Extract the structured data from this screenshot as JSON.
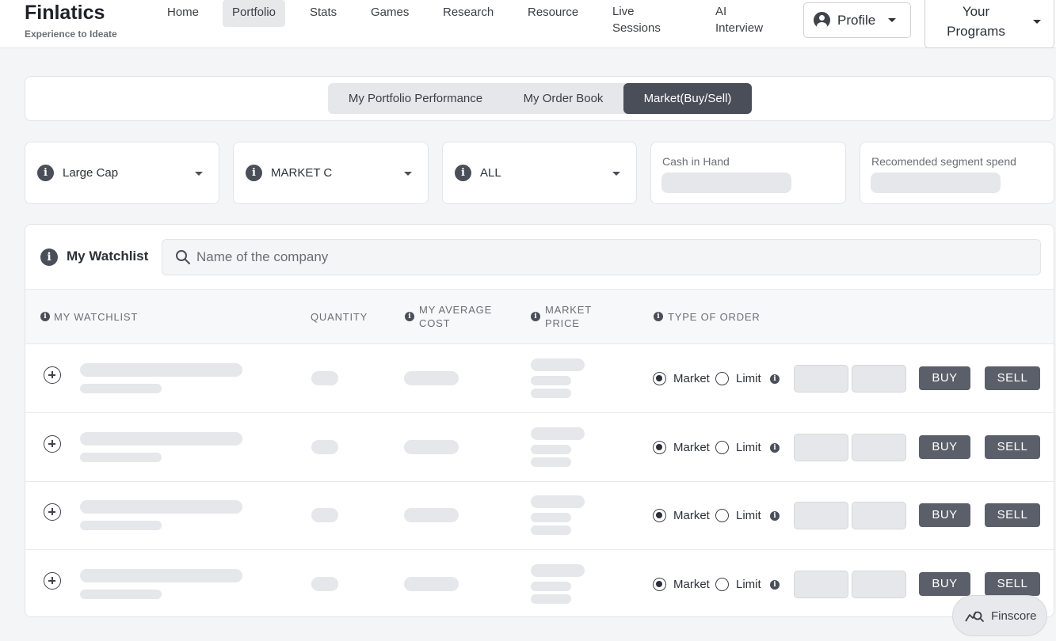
{
  "brand": {
    "name": "Finlatics",
    "tagline": "Experience to Ideate"
  },
  "nav": {
    "items": [
      {
        "label": "Home",
        "active": false
      },
      {
        "label": "Portfolio",
        "active": true
      },
      {
        "label": "Stats",
        "active": false
      },
      {
        "label": "Games",
        "active": false
      },
      {
        "label": "Research",
        "active": false
      },
      {
        "label": "Resource",
        "active": false
      },
      {
        "label": "Live\nSessions",
        "active": false
      },
      {
        "label": "AI\nInterview",
        "active": false
      }
    ],
    "profile_label": "Profile",
    "programs_label": "Your\nPrograms"
  },
  "tabs": [
    {
      "label": "My Portfolio Performance",
      "active": false
    },
    {
      "label": "My Order Book",
      "active": false
    },
    {
      "label": "Market(Buy/Sell)",
      "active": true
    }
  ],
  "filters": {
    "cap": "Large Cap",
    "market": "MARKET C",
    "segment": "ALL",
    "cash_label": "Cash in Hand",
    "recommended_label": "Recomended segment spend"
  },
  "watchlist": {
    "title": "My Watchlist",
    "search_placeholder": "Name of the company",
    "columns": {
      "name": "MY WATCHLIST",
      "quantity": "QUANTITY",
      "avg_cost": "MY AVERAGE\nCOST",
      "market_price": "MARKET\nPRICE",
      "order_type": "TYPE OF ORDER"
    },
    "order_options": {
      "market": "Market",
      "limit": "Limit"
    },
    "selected_order": "Market",
    "buy_label": "BUY",
    "sell_label": "SELL"
  },
  "finscore_label": "Finscore",
  "colors": {
    "accent_dark": "#4a4e58",
    "button": "#5b5f69",
    "skeleton": "#e6e7ea"
  },
  "icons": [
    "info-icon",
    "chevron-down-icon",
    "search-icon",
    "plus-circle-icon",
    "user-circle-icon",
    "chart-search-icon"
  ]
}
